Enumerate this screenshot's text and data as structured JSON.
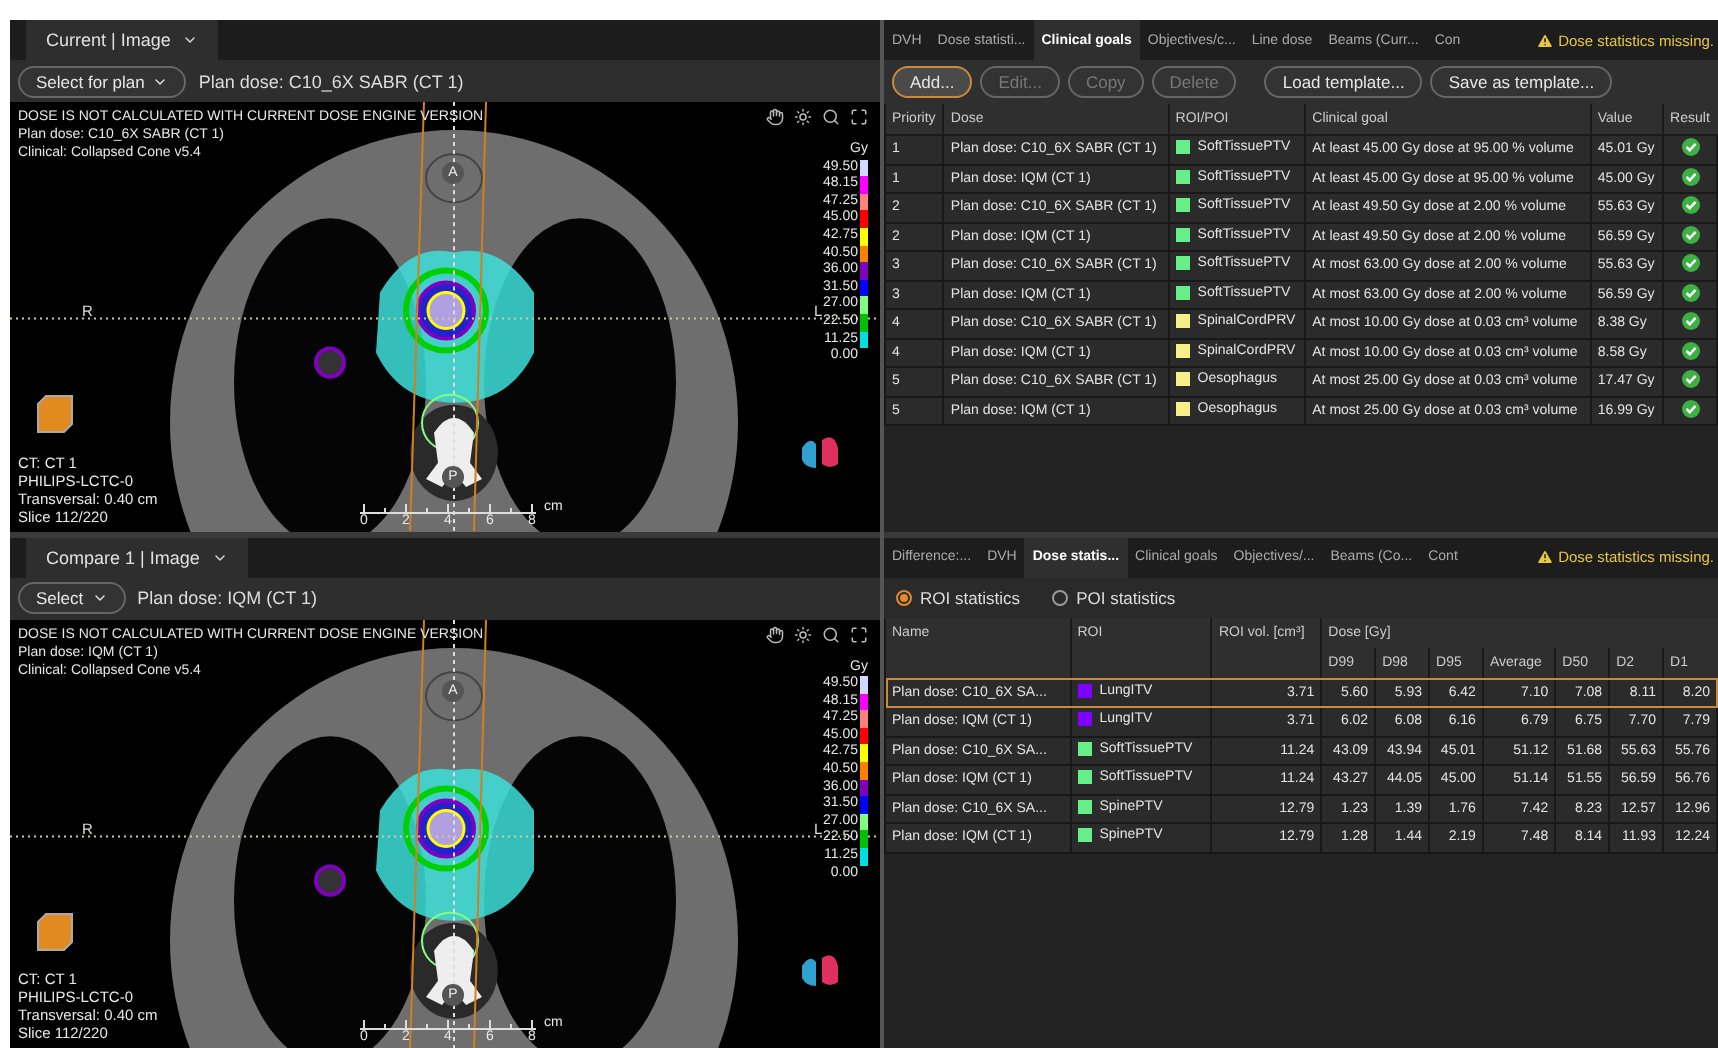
{
  "viewers": [
    {
      "tab": "Current | Image",
      "select_button": "Select for plan",
      "plan_label": "Plan dose: C10_6X SABR (CT 1)",
      "overlay_lines": [
        "DOSE IS NOT CALCULATED WITH CURRENT DOSE ENGINE VERSION",
        "Plan dose: C10_6X SABR (CT 1)",
        "Clinical: Collapsed Cone v5.4"
      ],
      "unit": "Gy",
      "legend": [
        {
          "value": "49.50",
          "color": "#d0d8ff"
        },
        {
          "value": "48.15",
          "color": "#ff00ff"
        },
        {
          "value": "47.25",
          "color": "#ff8080"
        },
        {
          "value": "45.00",
          "color": "#ff0000"
        },
        {
          "value": "42.75",
          "color": "#ffff00"
        },
        {
          "value": "40.50",
          "color": "#ff8000"
        },
        {
          "value": "36.00",
          "color": "#8000c0"
        },
        {
          "value": "31.50",
          "color": "#0000ff"
        },
        {
          "value": "27.00",
          "color": "#80ff80"
        },
        {
          "value": "22.50",
          "color": "#00c000"
        },
        {
          "value": "11.25",
          "color": "#00e0e0"
        },
        {
          "value": "0.00"
        }
      ],
      "orientation": {
        "top": "A",
        "left": "R",
        "right": "L",
        "bottom": "P"
      },
      "info_lines": [
        "CT: CT 1",
        "PHILIPS-LCTC-0",
        "Transversal: 0.40 cm",
        "Slice 112/220"
      ],
      "scale": {
        "ticks": [
          "0",
          "2",
          "4",
          "6",
          "8"
        ],
        "unit": "cm"
      }
    },
    {
      "tab": "Compare 1 | Image",
      "select_button": "Select",
      "plan_label": "Plan dose: IQM (CT 1)",
      "overlay_lines": [
        "DOSE IS NOT CALCULATED WITH CURRENT DOSE ENGINE VERSION",
        "Plan dose: IQM (CT 1)",
        "Clinical: Collapsed Cone v5.4"
      ],
      "unit": "Gy",
      "legend": [
        {
          "value": "49.50",
          "color": "#d0d8ff"
        },
        {
          "value": "48.15",
          "color": "#ff00ff"
        },
        {
          "value": "47.25",
          "color": "#ff8080"
        },
        {
          "value": "45.00",
          "color": "#ff0000"
        },
        {
          "value": "42.75",
          "color": "#ffff00"
        },
        {
          "value": "40.50",
          "color": "#ff8000"
        },
        {
          "value": "36.00",
          "color": "#8000c0"
        },
        {
          "value": "31.50",
          "color": "#0000ff"
        },
        {
          "value": "27.00",
          "color": "#80ff80"
        },
        {
          "value": "22.50",
          "color": "#00c000"
        },
        {
          "value": "11.25",
          "color": "#00e0e0"
        },
        {
          "value": "0.00"
        }
      ],
      "orientation": {
        "top": "A",
        "left": "R",
        "right": "L",
        "bottom": "P"
      },
      "info_lines": [
        "CT: CT 1",
        "PHILIPS-LCTC-0",
        "Transversal: 0.40 cm",
        "Slice 112/220"
      ],
      "scale": {
        "ticks": [
          "0",
          "2",
          "4",
          "6",
          "8"
        ],
        "unit": "cm"
      }
    }
  ],
  "goals_panel": {
    "tabs": [
      {
        "label": "DVH",
        "selected": false
      },
      {
        "label": "Dose statisti...",
        "selected": false
      },
      {
        "label": "Clinical goals",
        "selected": true
      },
      {
        "label": "Objectives/c...",
        "selected": false
      },
      {
        "label": "Line dose",
        "selected": false
      },
      {
        "label": "Beams (Curr...",
        "selected": false
      },
      {
        "label": "Con",
        "selected": false
      }
    ],
    "warning": "Dose statistics missing.",
    "buttons": [
      {
        "label": "Add...",
        "disabled": false,
        "focused": true
      },
      {
        "label": "Edit...",
        "disabled": true,
        "focused": false
      },
      {
        "label": "Copy",
        "disabled": true,
        "focused": false
      },
      {
        "label": "Delete",
        "disabled": true,
        "focused": false
      },
      {
        "label": "Load template...",
        "disabled": false,
        "focused": false
      },
      {
        "label": "Save as template...",
        "disabled": false,
        "focused": false
      }
    ],
    "columns": [
      "Priority",
      "Dose",
      "ROI/POI",
      "Clinical goal",
      "Value",
      "Result"
    ],
    "rows": [
      {
        "priority": "1",
        "dose": "Plan dose: C10_6X SABR (CT 1)",
        "roi": "SoftTissuePTV",
        "color": "#66ee88",
        "goal": "At least 45.00 Gy dose at 95.00 % volume",
        "value": "45.01 Gy",
        "passed": true
      },
      {
        "priority": "1",
        "dose": "Plan dose: IQM (CT 1)",
        "roi": "SoftTissuePTV",
        "color": "#66ee88",
        "goal": "At least 45.00 Gy dose at 95.00 % volume",
        "value": "45.00 Gy",
        "passed": true
      },
      {
        "priority": "2",
        "dose": "Plan dose: C10_6X SABR (CT 1)",
        "roi": "SoftTissuePTV",
        "color": "#66ee88",
        "goal": "At least 49.50 Gy dose at 2.00 % volume",
        "value": "55.63 Gy",
        "passed": true
      },
      {
        "priority": "2",
        "dose": "Plan dose: IQM (CT 1)",
        "roi": "SoftTissuePTV",
        "color": "#66ee88",
        "goal": "At least 49.50 Gy dose at 2.00 % volume",
        "value": "56.59 Gy",
        "passed": true
      },
      {
        "priority": "3",
        "dose": "Plan dose: C10_6X SABR (CT 1)",
        "roi": "SoftTissuePTV",
        "color": "#66ee88",
        "goal": "At most 63.00 Gy dose at 2.00 % volume",
        "value": "55.63 Gy",
        "passed": true
      },
      {
        "priority": "3",
        "dose": "Plan dose: IQM (CT 1)",
        "roi": "SoftTissuePTV",
        "color": "#66ee88",
        "goal": "At most 63.00 Gy dose at 2.00 % volume",
        "value": "56.59 Gy",
        "passed": true
      },
      {
        "priority": "4",
        "dose": "Plan dose: C10_6X SABR (CT 1)",
        "roi": "SpinalCordPRV",
        "color": "#f5f08a",
        "goal": "At most 10.00 Gy dose at 0.03 cm³ volume",
        "value": "8.38 Gy",
        "passed": true
      },
      {
        "priority": "4",
        "dose": "Plan dose: IQM (CT 1)",
        "roi": "SpinalCordPRV",
        "color": "#f5f08a",
        "goal": "At most 10.00 Gy dose at 0.03 cm³ volume",
        "value": "8.58 Gy",
        "passed": true
      },
      {
        "priority": "5",
        "dose": "Plan dose: C10_6X SABR (CT 1)",
        "roi": "Oesophagus",
        "color": "#f5f08a",
        "goal": "At most 25.00 Gy dose at 0.03 cm³ volume",
        "value": "17.47 Gy",
        "passed": true
      },
      {
        "priority": "5",
        "dose": "Plan dose: IQM (CT 1)",
        "roi": "Oesophagus",
        "color": "#f5f08a",
        "goal": "At most 25.00 Gy dose at 0.03 cm³ volume",
        "value": "16.99 Gy",
        "passed": true
      }
    ]
  },
  "stats_panel": {
    "tabs": [
      {
        "label": "Difference:...",
        "selected": false
      },
      {
        "label": "DVH",
        "selected": false
      },
      {
        "label": "Dose statis...",
        "selected": true
      },
      {
        "label": "Clinical goals",
        "selected": false
      },
      {
        "label": "Objectives/...",
        "selected": false
      },
      {
        "label": "Beams (Co...",
        "selected": false
      },
      {
        "label": "Cont",
        "selected": false
      }
    ],
    "warning": "Dose statistics missing.",
    "radios": [
      {
        "label": "ROI statistics",
        "selected": true
      },
      {
        "label": "POI statistics",
        "selected": false
      }
    ],
    "columns": [
      "Name",
      "ROI",
      "ROI vol. [cm³]"
    ],
    "dose_group": "Dose [Gy]",
    "dose_columns": [
      "D99",
      "D98",
      "D95",
      "Average",
      "D50",
      "D2",
      "D1"
    ],
    "rows": [
      {
        "name": "Plan dose: C10_6X SA...",
        "roi": "LungITV",
        "color": "#8000ff",
        "volume": "3.71",
        "values": [
          "5.60",
          "5.93",
          "6.42",
          "7.10",
          "7.08",
          "8.11",
          "8.20"
        ],
        "selected": true
      },
      {
        "name": "Plan dose: IQM (CT 1)",
        "roi": "LungITV",
        "color": "#8000ff",
        "volume": "3.71",
        "values": [
          "6.02",
          "6.08",
          "6.16",
          "6.79",
          "6.75",
          "7.70",
          "7.79"
        ],
        "selected": false
      },
      {
        "name": "Plan dose: C10_6X SA...",
        "roi": "SoftTissuePTV",
        "color": "#66ee88",
        "volume": "11.24",
        "values": [
          "43.09",
          "43.94",
          "45.01",
          "51.12",
          "51.68",
          "55.63",
          "55.76"
        ],
        "selected": false
      },
      {
        "name": "Plan dose: IQM (CT 1)",
        "roi": "SoftTissuePTV",
        "color": "#66ee88",
        "volume": "11.24",
        "values": [
          "43.27",
          "44.05",
          "45.00",
          "51.14",
          "51.55",
          "56.59",
          "56.76"
        ],
        "selected": false
      },
      {
        "name": "Plan dose: C10_6X SA...",
        "roi": "SpinePTV",
        "color": "#66ee88",
        "volume": "12.79",
        "values": [
          "1.23",
          "1.39",
          "1.76",
          "7.42",
          "8.23",
          "12.57",
          "12.96"
        ],
        "selected": false
      },
      {
        "name": "Plan dose: IQM (CT 1)",
        "roi": "SpinePTV",
        "color": "#66ee88",
        "volume": "12.79",
        "values": [
          "1.28",
          "1.44",
          "2.19",
          "7.48",
          "8.14",
          "11.93",
          "12.24"
        ],
        "selected": false
      }
    ]
  }
}
